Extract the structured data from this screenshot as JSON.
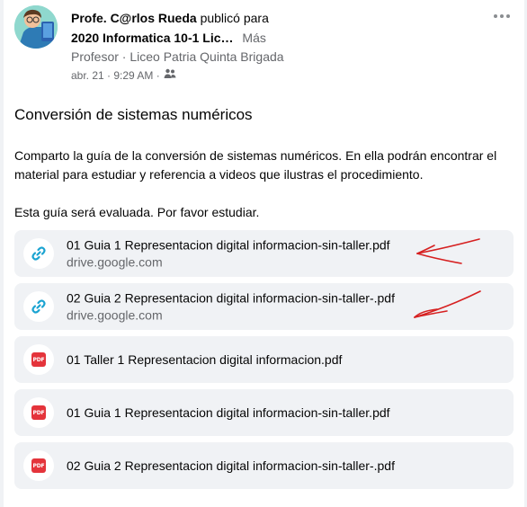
{
  "post": {
    "author": "Profe. C@rlos Rueda",
    "action": "publicó para",
    "group": "2020 Informatica 10-1 Lic…",
    "more_label": "Más",
    "role": "Profesor · Liceo Patria Quinta Brigada",
    "timestamp": "abr. 21 · 9:29 AM ·",
    "title": "Conversión de sistemas numéricos",
    "body_paragraph_1": "Comparto la guía de la conversión de sistemas numéricos. En ella podrán encontrar el material para estudiar y referencia a videos que ilustras el procedimiento.",
    "body_paragraph_2": "Esta guía será evaluada. Por favor estudiar."
  },
  "attachments": [
    {
      "kind": "link",
      "icon": "link-icon",
      "title": "01 Guia 1 Representacion digital informacion-sin-taller.pdf",
      "domain": "drive.google.com"
    },
    {
      "kind": "link",
      "icon": "link-icon",
      "title": "02 Guia 2 Representacion digital informacion-sin-taller-.pdf",
      "domain": "drive.google.com"
    },
    {
      "kind": "pdf",
      "icon": "pdf-icon",
      "title": "01 Taller 1 Representacion digital informacion.pdf"
    },
    {
      "kind": "pdf",
      "icon": "pdf-icon",
      "title": "01 Guia 1 Representacion digital informacion-sin-taller.pdf"
    },
    {
      "kind": "pdf",
      "icon": "pdf-icon",
      "title": "02 Guia 2 Representacion digital informacion-sin-taller-.pdf"
    }
  ],
  "icons": {
    "more": "more-options-icon",
    "audience": "group-audience-icon",
    "pdf_badge_text": "PDF"
  },
  "colors": {
    "link_icon": "#1aa3d1",
    "pdf_badge": "#e4343b",
    "annotation_arrow": "#d62020",
    "attachment_bg": "#f0f2f5"
  }
}
